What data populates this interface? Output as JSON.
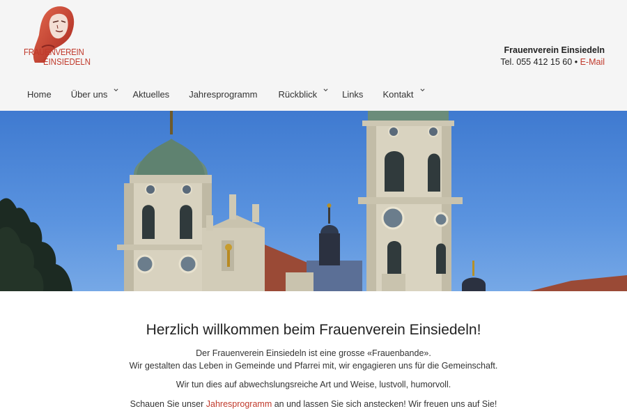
{
  "logo": {
    "line1": "FRAUENVEREIN",
    "line2": "EINSIEDELN",
    "icon": "woman-portrait-logo"
  },
  "contact": {
    "name": "Frauenverein Einsiedeln",
    "phone": "Tel. 055 412 15 60",
    "separator": "•",
    "email_label": "E-Mail"
  },
  "nav": {
    "items": [
      {
        "label": "Home"
      },
      {
        "label": "Über uns"
      },
      {
        "label": "Aktuelles"
      },
      {
        "label": "Jahresprogramm"
      },
      {
        "label": "Rückblick"
      },
      {
        "label": "Links"
      },
      {
        "label": "Kontakt"
      }
    ]
  },
  "hero": {
    "subject": "church-towers-photo"
  },
  "main": {
    "title": "Herzlich willkommen beim Frauenverein Einsiedeln!",
    "para1_line1": "Der Frauenverein Einsiedeln ist eine grosse «Frauenbande».",
    "para1_line2": "Wir gestalten das Leben in Gemeinde und Pfarrei mit, wir engagieren uns für die Gemeinschaft.",
    "para2": "Wir tun dies auf abwechslungsreiche Art und Weise, lustvoll, humorvoll.",
    "para3_before": "Schauen Sie unser ",
    "para3_link": "Jahresprogramm",
    "para3_after": " an und lassen Sie sich anstecken! Wir freuen uns auf Sie!"
  },
  "colors": {
    "accent": "#c0392b",
    "header_bg": "#f5f5f5",
    "sky": "#4a86d8"
  }
}
